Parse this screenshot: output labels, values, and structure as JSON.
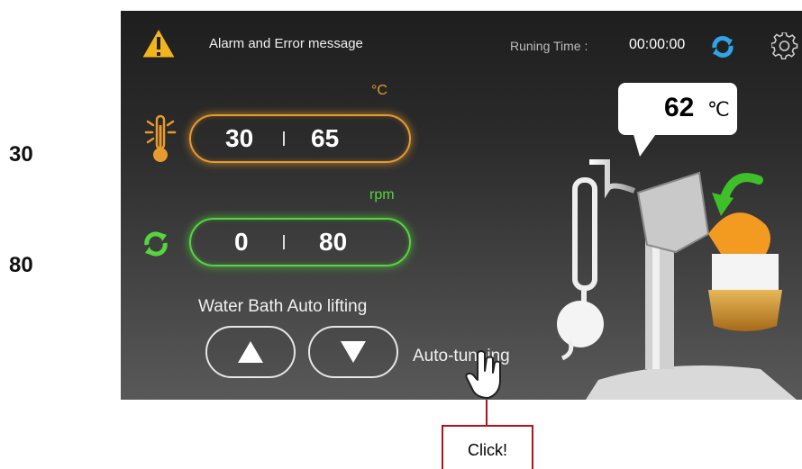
{
  "outside": {
    "temp_label": "30",
    "rpm_label": "80"
  },
  "header": {
    "alarm_text": "Alarm and Error message",
    "running_time_label": "Runing Time :",
    "running_time_value": "00:00:00"
  },
  "temperature": {
    "unit": "°C",
    "low": "30",
    "high": "65"
  },
  "rotation": {
    "unit": "rpm",
    "low": "0",
    "high": "80"
  },
  "lifting": {
    "label": "Water Bath Auto lifting"
  },
  "auto_tuning": {
    "label": "Auto-tunning"
  },
  "vapor_temp": {
    "value": "62",
    "unit": "℃"
  },
  "callout": {
    "text": "Click!"
  },
  "colors": {
    "accent_temp": "#e79a2e",
    "accent_rpm": "#54d63e",
    "alarm": "#f2b51d",
    "callout_border": "#b5121b"
  },
  "icons": [
    "warning-icon",
    "refresh-icon",
    "gear-icon",
    "thermometer-icon",
    "rotation-icon",
    "arrow-up-icon",
    "arrow-down-icon",
    "hand-cursor-icon",
    "rotate-arrow-icon"
  ]
}
